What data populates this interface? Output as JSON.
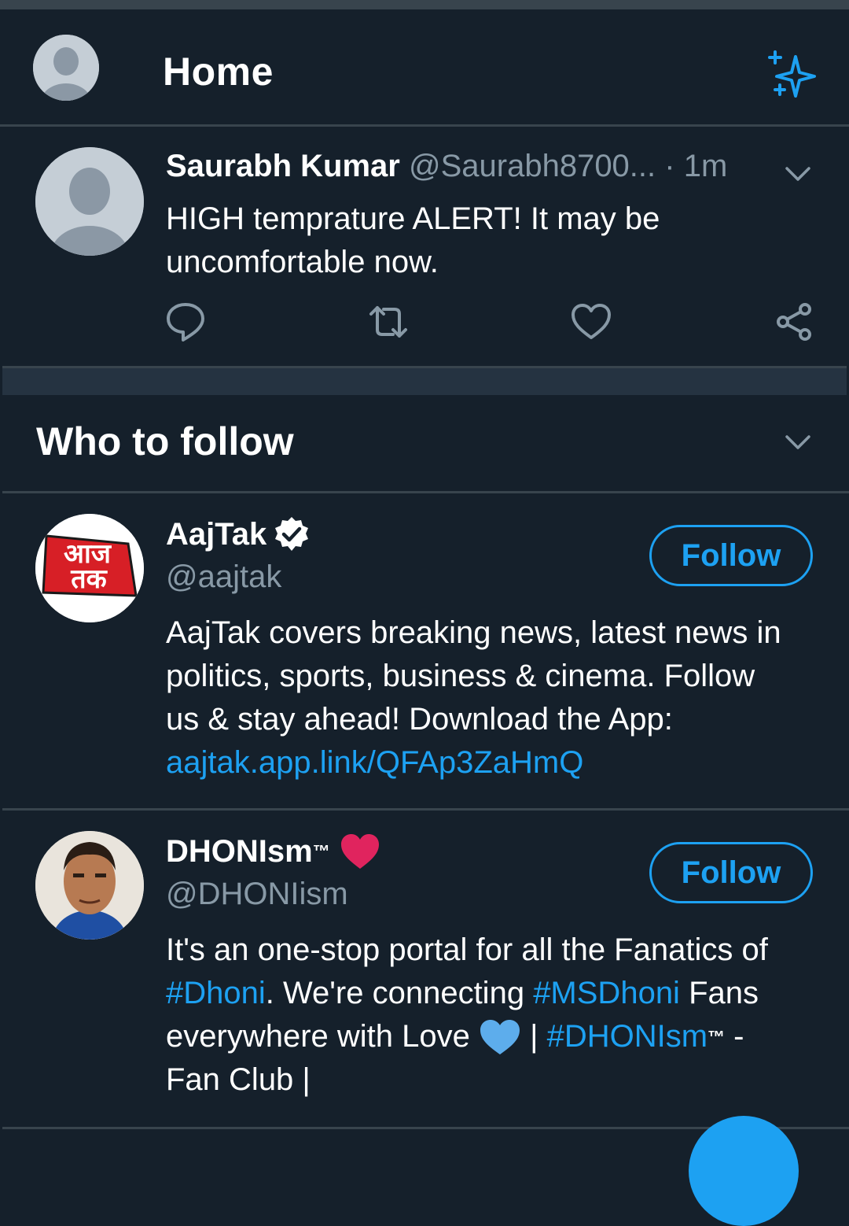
{
  "header": {
    "title": "Home",
    "avatar_icon": "default-avatar-icon",
    "sparkle_icon": "sparkle-icon"
  },
  "tweet": {
    "name": "Saurabh Kumar",
    "handle": "@Saurabh8700...",
    "dot": "·",
    "time": "1m",
    "text_line1": "HIGH temprature ALERT! It may be",
    "text_line2": "uncomfortable now."
  },
  "who_to_follow": {
    "title": "Who to follow",
    "follow_label": "Follow",
    "accounts": [
      {
        "name": "AajTak",
        "handle": "@aajtak",
        "bio_line1": "AajTak covers breaking news, latest news in",
        "bio_line2": "politics, sports, business & cinema. Follow",
        "bio_line3": "us & stay ahead! Download the App:",
        "bio_link": "aajtak.app.link/QFAp3ZaHmQ",
        "logo_text_1": "आज",
        "logo_text_2": "तक"
      },
      {
        "name": "DHONIsm",
        "name_tm": "™",
        "handle": "@DHONIism",
        "bio_line1": "It's an one-stop portal for all the Fanatics of",
        "bio_tag1": "#Dhoni",
        "bio_mid1": ". We're connecting ",
        "bio_tag2": "#MSDhoni",
        "bio_mid2": " Fans",
        "bio_line3a": "everywhere with Love ",
        "bio_line3b": " | ",
        "bio_tag3": "#DHONIsm",
        "bio_tm": "™",
        "bio_line3c": " -",
        "bio_line4": "Fan Club |"
      }
    ]
  },
  "colors": {
    "background": "#15202b",
    "accent": "#1da1f2",
    "muted": "#8899a6",
    "border": "#38444d",
    "heart_red": "#e0245e"
  }
}
